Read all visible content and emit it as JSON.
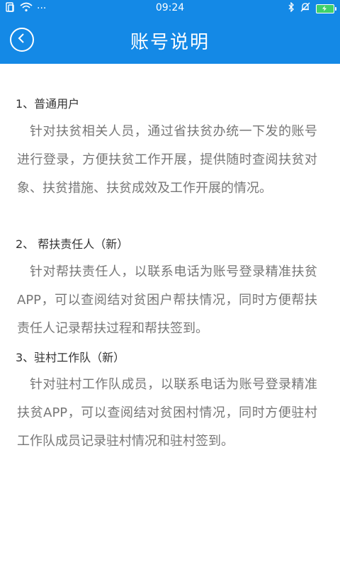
{
  "status_bar": {
    "time": "09:24",
    "left_icons": [
      "sim-icon",
      "wifi-icon",
      "more-dots-icon"
    ],
    "right_icons": [
      "bluetooth-icon",
      "mute-icon",
      "battery-icon"
    ],
    "dots": "···"
  },
  "header": {
    "title": "账号说明",
    "back_icon": "back-circle-icon",
    "background": "#1489e6"
  },
  "sections": [
    {
      "title": "1、普通用户",
      "body": "针对扶贫相关人员，通过省扶贫办统一下发的账号进行登录，方便扶贫工作开展，提供随时查阅扶贫对象、扶贫措施、扶贫成效及工作开展的情况。"
    },
    {
      "title": "2、 帮扶责任人（新）",
      "body": "针对帮扶责任人，以联系电话为账号登录精准扶贫APP，可以查阅结对贫困户帮扶情况，同时方便帮扶责任人记录帮扶过程和帮扶签到。"
    },
    {
      "title": "3、驻村工作队（新）",
      "body": "针对驻村工作队成员，以联系电话为账号登录精准扶贫APP，可以查阅结对贫困村情况，同时方便驻村工作队成员记录驻村情况和驻村签到。"
    }
  ]
}
